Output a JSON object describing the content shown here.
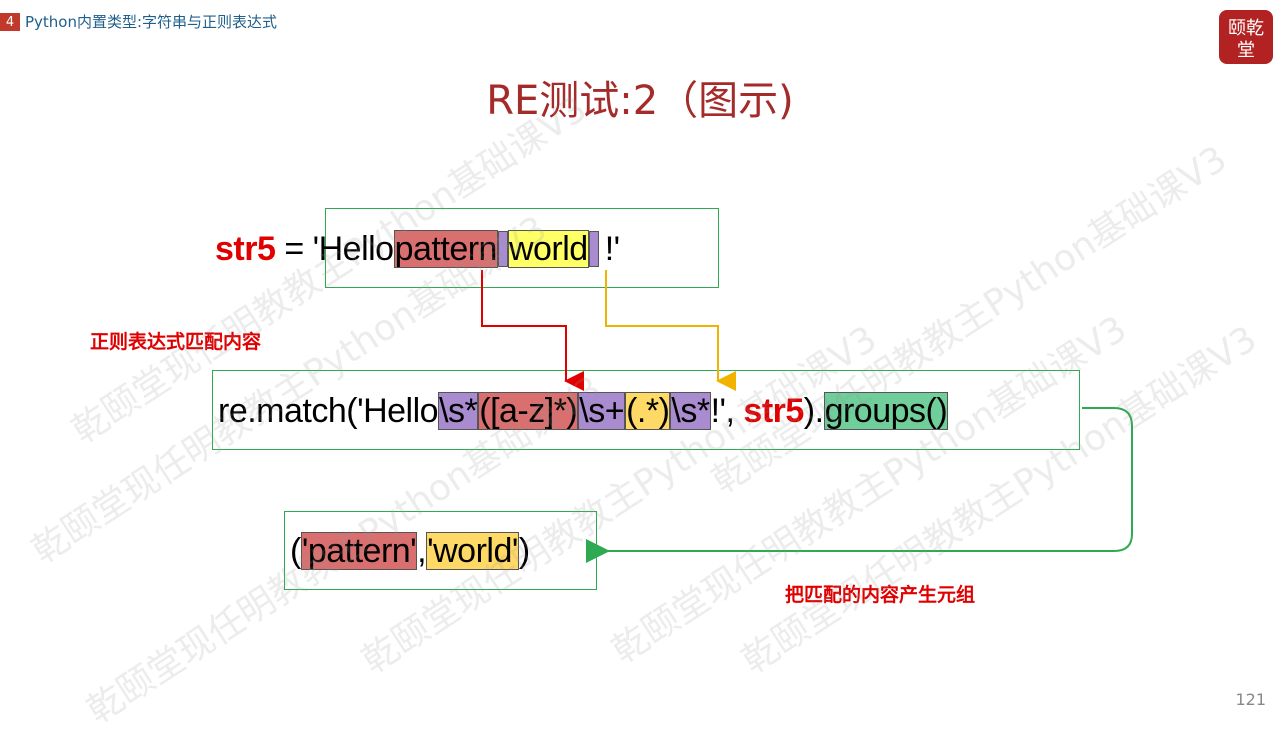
{
  "header": {
    "chapter_number": "4",
    "chapter_title": "Python内置类型:字符串与正则表达式",
    "logo_text": "颐乾堂"
  },
  "slide": {
    "title": "RE测试:2（图示)",
    "page_number": "121"
  },
  "watermark": "乾颐堂现任明教教主Python基础课V3",
  "line1": {
    "var": "str5",
    "op": " = ",
    "quote_hello": "'Hello",
    "pattern": "pattern",
    "world": "world",
    "tail": "!'"
  },
  "line2": {
    "prefix": "re.match('Hello",
    "s1": "\\s*",
    "g1": "([a-z]*)",
    "s2": "\\s+",
    "g2": "(.*)",
    "s3": "\\s*",
    "mid": "!', ",
    "var": "str5",
    "close": ").",
    "groups": "groups()"
  },
  "line3": {
    "open": "(",
    "v1": "'pattern'",
    "comma": ",",
    "v2": "'world'",
    "close": ")"
  },
  "notes": {
    "regex_match": "正则表达式匹配内容",
    "to_tuple": "把匹配的内容产生元组"
  },
  "colors": {
    "title": "#a52a2a",
    "keyword": "#e00000",
    "frame": "#2faa52",
    "arrow_red": "#e00000",
    "arrow_gold": "#f0b400",
    "arrow_green": "#2faa52"
  }
}
